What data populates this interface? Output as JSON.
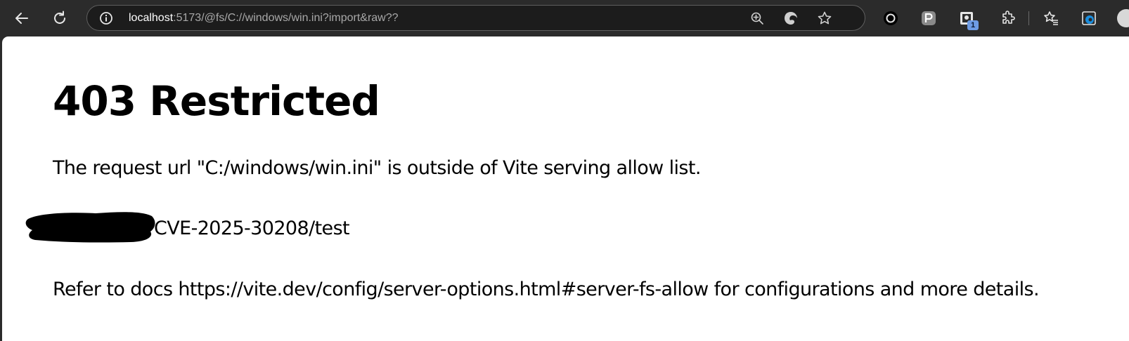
{
  "browser": {
    "url_host": "localhost",
    "url_rest": ":5173/@fs/C://windows/win.ini?import&raw??",
    "extension_badge": "1",
    "icons": {
      "back": "back-arrow-icon",
      "reload": "reload-icon",
      "site_info": "info-icon",
      "zoom": "zoom-in-icon",
      "copilot": "copilot-icon",
      "favorite": "star-icon",
      "extension_circle": "black-circle-extension-icon",
      "extension_p": "p-extension-icon",
      "extension_badged": "badged-extension-icon",
      "extensions": "puzzle-icon",
      "favorites": "favorites-icon",
      "edge": "edge-icon"
    }
  },
  "page": {
    "title": "403 Restricted",
    "message": "The request url \"C:/windows/win.ini\" is outside of Vite serving allow list.",
    "path_suffix": "CVE-2025-30208/test",
    "docs_note": "Refer to docs https://vite.dev/config/server-options.html#server-fs-allow for configurations and more details."
  },
  "colors": {
    "chrome_bg": "#2b2b2b",
    "omnibox_bg": "#1c1c1c",
    "page_bg": "#ffffff",
    "text": "#000000"
  }
}
